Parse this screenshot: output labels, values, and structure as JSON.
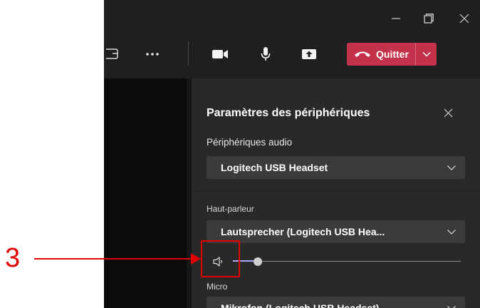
{
  "toolbar": {
    "leave_label": "Quitter"
  },
  "settings_panel": {
    "title": "Paramètres des périphériques",
    "audio_devices": {
      "label": "Périphériques audio",
      "value": "Logitech USB Headset"
    },
    "speaker": {
      "label": "Haut-parleur",
      "value": "Lautsprecher (Logitech USB Hea...",
      "volume_percent": 11
    },
    "microphone": {
      "label": "Micro",
      "value": "Mikrofon (Logitech USB Headset)"
    }
  },
  "annotation": {
    "number": "3",
    "color": "#e00000"
  },
  "colors": {
    "leave_button": "#c4314b",
    "slider_fill": "#a9a6ff",
    "panel_bg": "#292929",
    "app_bg": "#1f1f1f"
  }
}
